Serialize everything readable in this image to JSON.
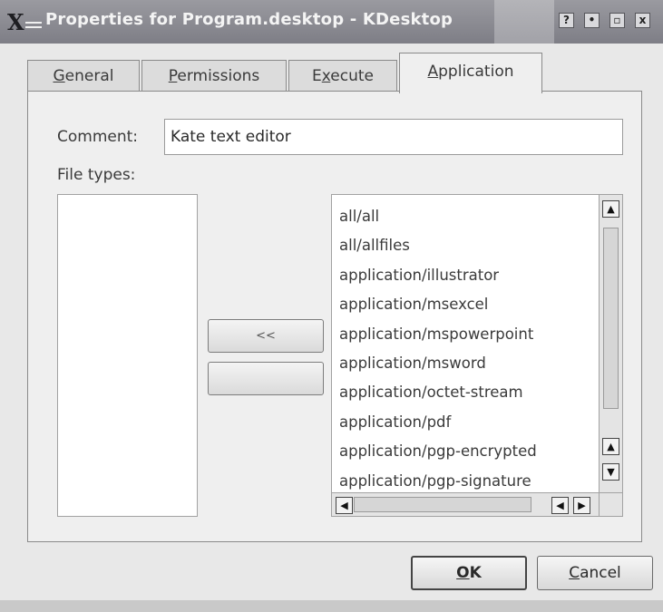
{
  "window": {
    "title": "Properties for Program.desktop - KDesktop",
    "buttons": {
      "help": "?",
      "minimize": "•",
      "maximize": "▫",
      "close": "x"
    }
  },
  "tabs": [
    {
      "pre": "",
      "mnemonic": "G",
      "post": "eneral"
    },
    {
      "pre": "",
      "mnemonic": "P",
      "post": "ermissions"
    },
    {
      "pre": "E",
      "mnemonic": "x",
      "post": "ecute"
    },
    {
      "pre": "",
      "mnemonic": "A",
      "post": "pplication"
    }
  ],
  "form": {
    "comment_label": "Comment:",
    "comment_value": "Kate text editor",
    "filetypes_label": "File types:"
  },
  "move_buttons": {
    "add_label": "<<",
    "remove_label": ""
  },
  "mime_types": [
    "all/all",
    "all/allfiles",
    "application/illustrator",
    "application/msexcel",
    "application/mspowerpoint",
    "application/msword",
    "application/octet-stream",
    "application/pdf",
    "application/pgp-encrypted",
    "application/pgp-signature"
  ],
  "footer": {
    "ok": {
      "mnemonic": "O",
      "post": "K"
    },
    "cancel": {
      "mnemonic": "C",
      "post": "ancel"
    }
  },
  "icons": {
    "scroll_up": "▲",
    "scroll_down": "▼",
    "scroll_left": "◀",
    "scroll_right": "▶"
  }
}
